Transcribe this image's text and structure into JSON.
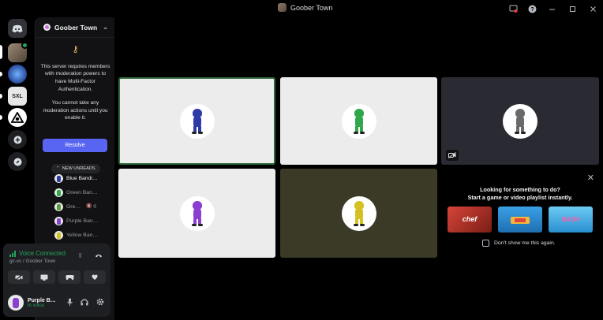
{
  "titlebar": {
    "title": "Goober Town",
    "icons": [
      "screen-record-icon",
      "help-icon",
      "minimize-icon",
      "maximize-icon",
      "close-icon"
    ]
  },
  "rail": {
    "items": [
      "discord-home-icon",
      "server-avatar-goober-town",
      "server-avatar-blue-orb",
      "server-avatar-sxl",
      "server-avatar-triangle-eye",
      "add-server-icon",
      "discover-icon"
    ]
  },
  "sidebar": {
    "server_name": "Goober Town",
    "mfa_notice_1": "This server requires members with moderation powers to have Multi-Factor Authentication.",
    "mfa_notice_2": "You cannot take any moderation actions until you enable it.",
    "resolve_label": "Resolve",
    "new_unreads_label": "NEW UNREADS",
    "voice_members": [
      {
        "name": "Blue Bandi…",
        "color": "#2d3aa8",
        "extra": ""
      },
      {
        "name": "Green Ban…",
        "color": "#2fa84a",
        "extra": ""
      },
      {
        "name": "Gre…",
        "color": "#5a9a3a",
        "extra": "🔇 ⦸"
      },
      {
        "name": "Purple Ban…",
        "color": "#8a3fd1",
        "extra": ""
      },
      {
        "name": "Yellow Ban…",
        "color": "#d4c021",
        "extra": ""
      }
    ]
  },
  "voice": {
    "status": "Voice Connected",
    "channel": "gc-vc / Goober Town",
    "user_name": "Purple B…",
    "user_status": "In voice"
  },
  "tiles": [
    {
      "name": "tile-blue",
      "bandi_color": "#2d3aa8",
      "bg": "#ececec"
    },
    {
      "name": "tile-green",
      "bandi_color": "#2fa84a",
      "bg": "#ececec"
    },
    {
      "name": "tile-gray",
      "bandi_color": "#6a6a6a",
      "bg": "#2a2a32"
    },
    {
      "name": "tile-purple",
      "bandi_color": "#8a3fd1",
      "bg": "#ececec"
    },
    {
      "name": "tile-yellow",
      "bandi_color": "#d4c021",
      "bg": "#3a3a26"
    }
  ],
  "activity": {
    "title_line1": "Looking for something to do?",
    "title_line2": "Start a game or video playlist instantly.",
    "games": [
      {
        "label": "chef",
        "bg": "#c2372a"
      },
      {
        "label": "",
        "bg": "#2f8fd6"
      },
      {
        "label": "BASH",
        "bg": "#4bb3e8"
      }
    ],
    "checkbox_label": "Don't show me this again."
  }
}
